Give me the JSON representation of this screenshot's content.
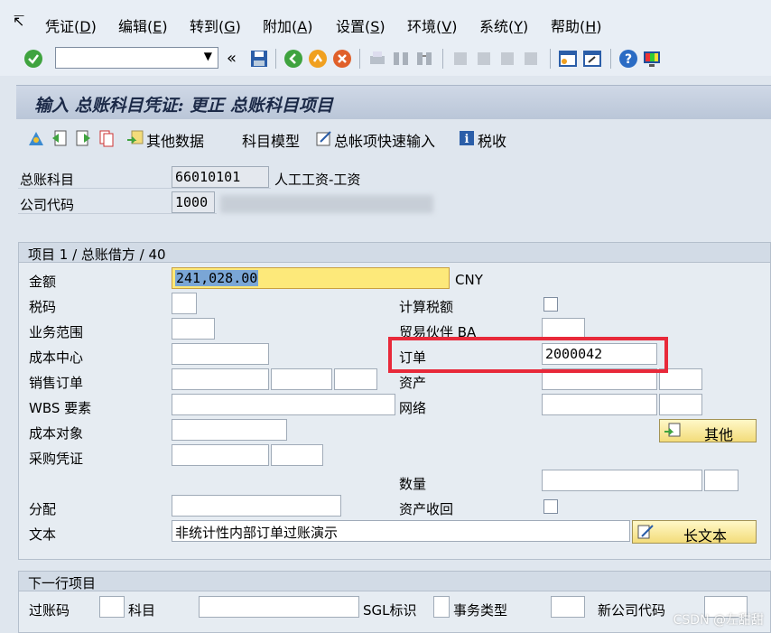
{
  "menu": {
    "items": [
      "凭证(",
      "编辑(",
      "转到(",
      "附加(",
      "设置(",
      "环境(",
      "系统(",
      "帮助("
    ],
    "accels": [
      "D",
      "E",
      "G",
      "A",
      "S",
      "V",
      "Y",
      "H"
    ]
  },
  "toolbar": {
    "back_label": "«"
  },
  "title": "输入 总账科目凭证: 更正 总账科目项目",
  "apptoolbar": {
    "other_data": "其他数据",
    "account_model": "科目模型",
    "fast_entry": "总帐项快速输入",
    "tax": "税收"
  },
  "header": {
    "gl_account_label": "总账科目",
    "gl_account_value": "66010101",
    "gl_account_desc": "人工工资-工资",
    "company_code_label": "公司代码",
    "company_code_value": "1000"
  },
  "item": {
    "title": "项目 1 / 总账借方 / 40",
    "amount_label": "金额",
    "amount_value": "241,028.00",
    "currency": "CNY",
    "tax_code_label": "税码",
    "calc_tax_label": "计算税额",
    "business_area_label": "业务范围",
    "trading_partner_label": "贸易伙伴 BA",
    "cost_center_label": "成本中心",
    "order_label": "订单",
    "order_value": "2000042",
    "sales_order_label": "销售订单",
    "asset_label": "资产",
    "wbs_label": "WBS 要素",
    "network_label": "网络",
    "cost_object_label": "成本对象",
    "other_button": "其他",
    "po_label": "采购凭证",
    "quantity_label": "数量",
    "assignment_label": "分配",
    "asset_retirement_label": "资产收回",
    "text_label": "文本",
    "text_value": "非统计性内部订单过账演示",
    "long_text_button": "长文本"
  },
  "next_item": {
    "title": "下一行项目",
    "posting_key_label": "过账码",
    "account_label": "科目",
    "sgl_label": "SGL标识",
    "trans_type_label": "事务类型",
    "new_cc_label": "新公司代码"
  },
  "watermark": "CSDN @左甜甜",
  "colors": {
    "highlight_red": "#e8293a",
    "title_text": "#1c2a48",
    "button_yellow": "#f3dc7a"
  }
}
